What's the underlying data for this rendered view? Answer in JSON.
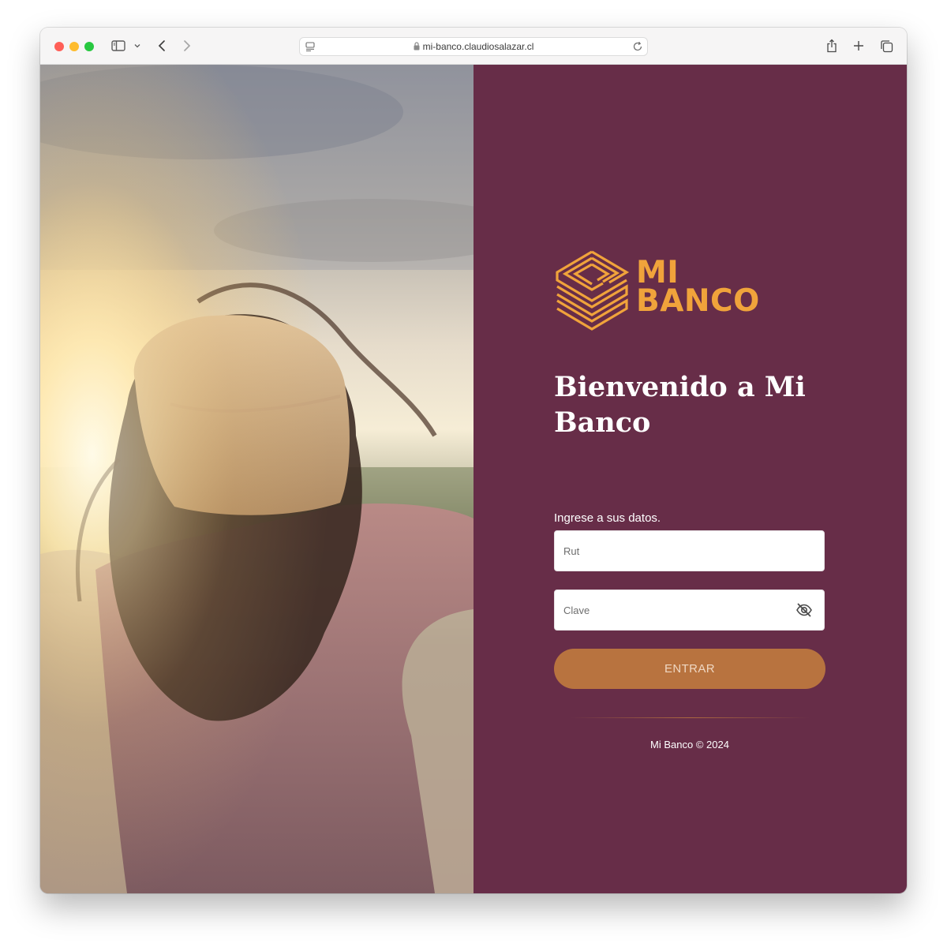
{
  "browser": {
    "url": "mi-banco.claudiosalazar.cl"
  },
  "brand": {
    "name_line1": "MI",
    "name_line2": "BANCO",
    "accent_color": "#f0a33b",
    "panel_color": "#672d48",
    "button_color": "#b8733f"
  },
  "login": {
    "title": "Bienvenido a Mi Banco",
    "subtitle": "Ingrese a sus datos.",
    "rut_placeholder": "Rut",
    "clave_placeholder": "Clave",
    "submit_label": "ENTRAR"
  },
  "footer": {
    "text": "Mi Banco © 2024"
  },
  "icons": {
    "password_toggle": "eye-slash-icon",
    "lock": "lock-icon",
    "sidebar": "sidebar-icon"
  }
}
